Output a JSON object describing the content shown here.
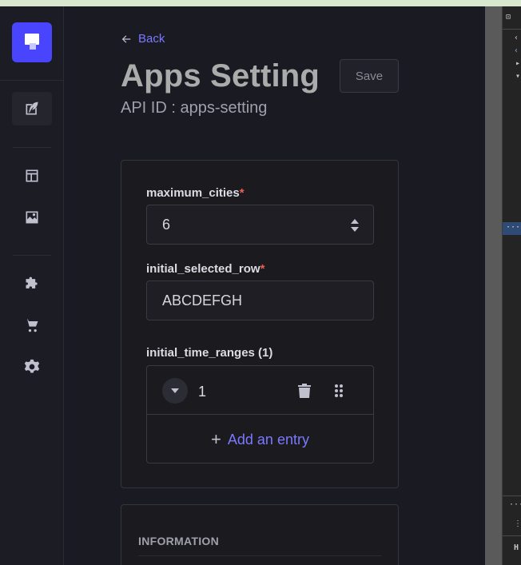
{
  "nav": {
    "items": [
      {
        "icon": "feather-icon"
      },
      {
        "icon": "layout-icon"
      },
      {
        "icon": "image-icon"
      },
      {
        "icon": "puzzle-icon"
      },
      {
        "icon": "cart-icon"
      },
      {
        "icon": "gear-icon"
      }
    ]
  },
  "header": {
    "back_label": "Back",
    "title": "Apps Setting",
    "api_id": "API ID : apps-setting",
    "save_label": "Save"
  },
  "form": {
    "maximum_cities": {
      "label": "maximum_cities",
      "required": "*",
      "value": "6"
    },
    "initial_selected_row": {
      "label": "initial_selected_row",
      "required": "*",
      "value": "ABCDEFGH"
    },
    "initial_time_ranges": {
      "label": "initial_time_ranges (1)",
      "entries": [
        {
          "number": "1"
        }
      ],
      "add_label": "Add an entry"
    }
  },
  "information": {
    "title": "INFORMATION"
  },
  "devtools": {
    "more": "···",
    "more2": "···",
    "letter": "H"
  },
  "colors": {
    "accent": "#7b79ff",
    "brand": "#4945ff",
    "required": "#ee5e52"
  }
}
